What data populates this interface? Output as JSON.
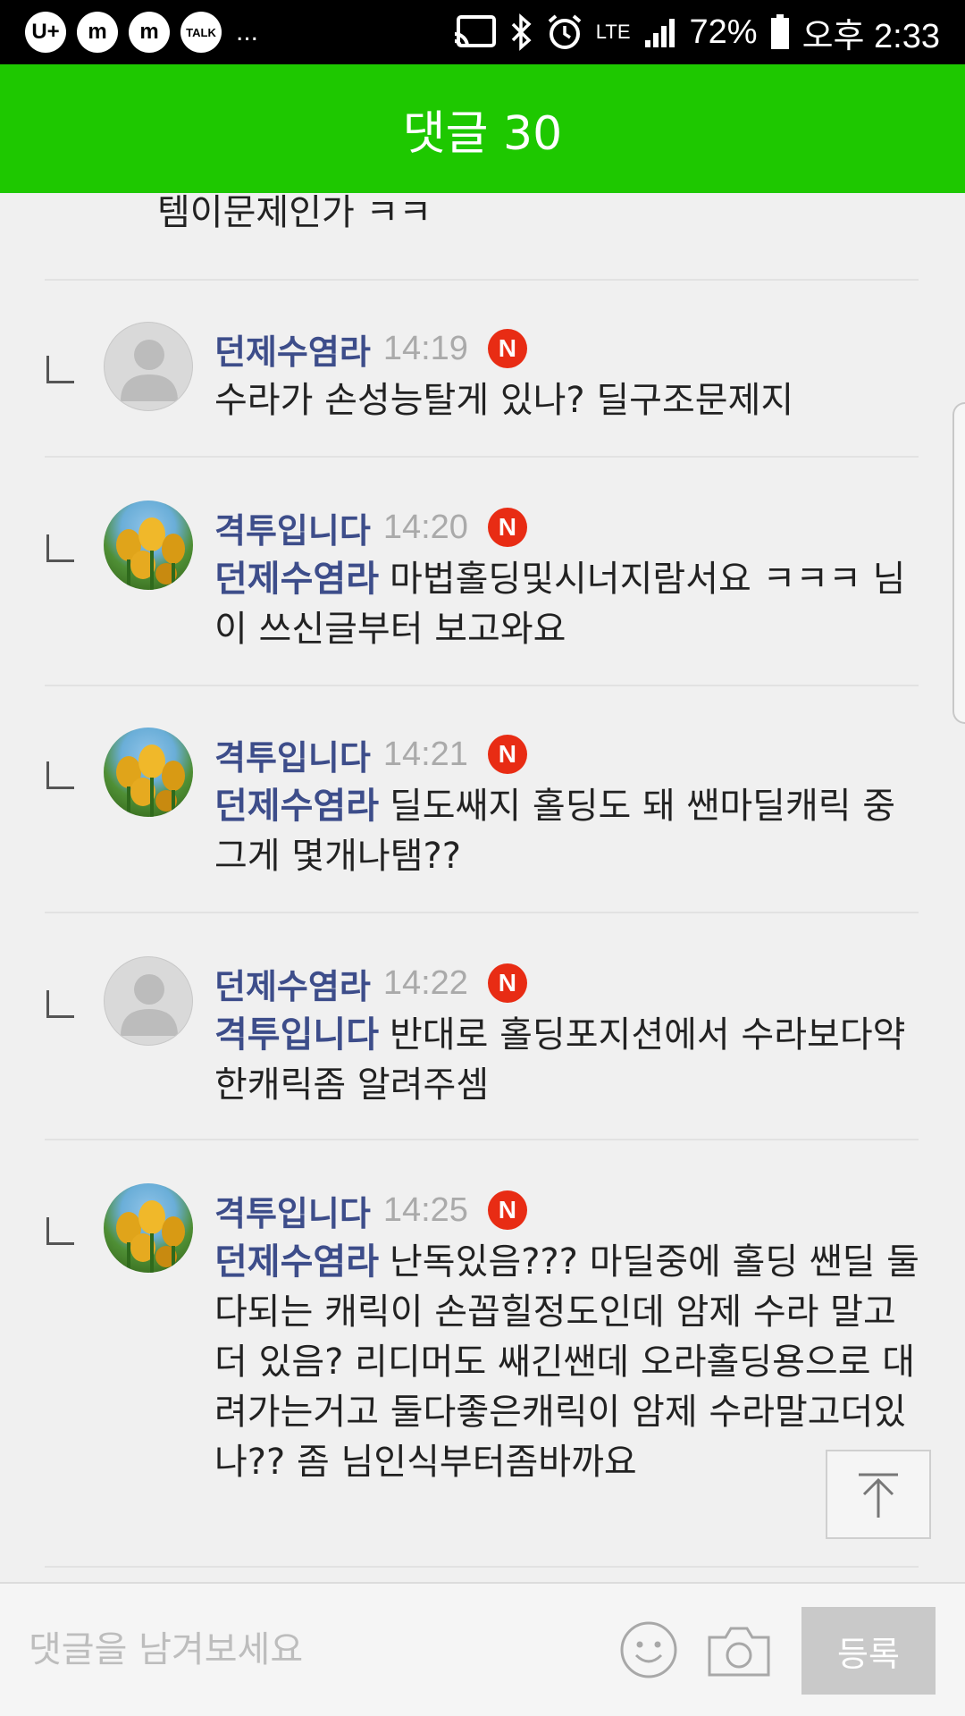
{
  "status_bar": {
    "battery": "72%",
    "clock": "오후 2:33",
    "network": "LTE",
    "app_icons": [
      "U+",
      "m",
      "m",
      "TALK"
    ],
    "more": "..."
  },
  "header": {
    "title": "댓글 30"
  },
  "list": {
    "prev_tail": "템이문제인가 ㅋㅋ",
    "comments": [
      {
        "author": "던제수염라",
        "time": "14:19",
        "badge": "N",
        "mention": "",
        "text": "수라가 손성능탈게 있나? 딜구조문제지",
        "avatar": "default-profile-icon"
      },
      {
        "author": "격투입니다",
        "time": "14:20",
        "badge": "N",
        "mention": "던제수염라",
        "text": "마법홀딩및시너지람서요 ㅋㅋㅋ 님이 쓰신글부터 보고와요",
        "avatar": "tulip-photo"
      },
      {
        "author": "격투입니다",
        "time": "14:21",
        "badge": "N",
        "mention": "던제수염라",
        "text": "딜도쌔지 홀딩도 돼 쌘마딜캐릭 중 그게 몇개나탬??",
        "avatar": "tulip-photo"
      },
      {
        "author": "던제수염라",
        "time": "14:22",
        "badge": "N",
        "mention": "격투입니다",
        "text": "반대로 홀딩포지션에서 수라보다약한캐릭좀 알려주셈",
        "avatar": "default-profile-icon"
      },
      {
        "author": "격투입니다",
        "time": "14:25",
        "badge": "N",
        "mention": "던제수염라",
        "text": "난독있음??? 마딜중에 홀딩 쌘딜 둘다되는 캐릭이 손꼽힐정도인데 암제 수라 말고 더 있음? 리디머도 쌔긴쌘데 오라홀딩용으로 대려가는거고 둘다좋은캐릭이 암제 수라말고더있나?? 좀 님인식부터좀바까요",
        "avatar": "tulip-photo"
      }
    ]
  },
  "input_bar": {
    "placeholder": "댓글을 남겨보세요",
    "submit_label": "등록",
    "emoji_icon": "smiley-icon",
    "camera_icon": "camera-icon"
  },
  "colors": {
    "header_bg": "#1ec800",
    "author": "#3d4d8a",
    "new_badge": "#e82c14",
    "submit_bg": "#c9c9c9"
  }
}
